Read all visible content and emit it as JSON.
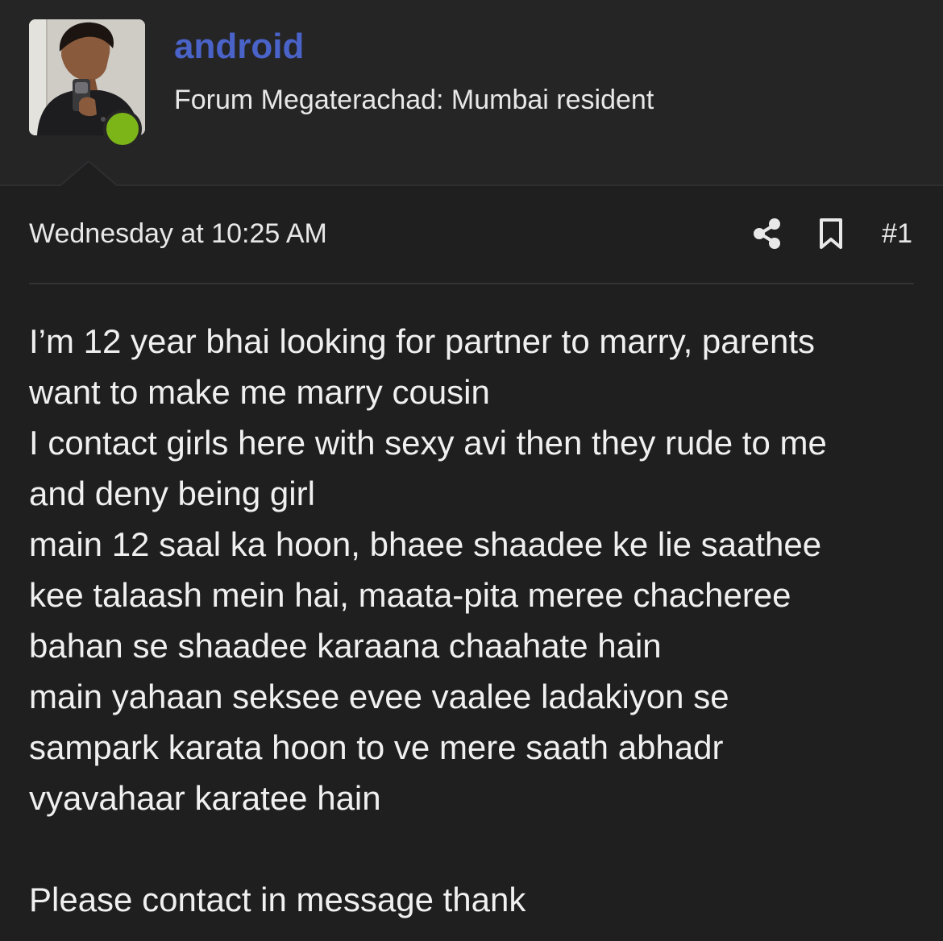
{
  "author": {
    "username": "android",
    "title": "Forum Megaterachad: Mumbai resident",
    "avatar_alt": "user avatar",
    "status": "online",
    "username_color": "#4a63c9",
    "online_color": "#7cb518"
  },
  "post": {
    "timestamp": "Wednesday at 10:25 AM",
    "number": "#1",
    "actions": [
      {
        "icon": "share-icon"
      },
      {
        "icon": "bookmark-icon"
      }
    ],
    "lines": [
      "I’m 12 year bhai looking for partner to marry, parents",
      "want to make me marry cousin",
      "I contact girls here with sexy avi then they rude to me",
      "and deny being girl",
      "main 12 saal ka hoon, bhaee shaadee ke lie saathee",
      "kee talaash mein hai, maata-pita meree chacheree",
      "bahan se shaadee karaana chaahate hain",
      "main yahaan seksee evee vaalee ladakiyon se",
      "sampark karata hoon to ve mere saath abhadr",
      "vyavahaar karatee hain",
      "",
      "Please contact in message thank"
    ]
  },
  "theme": {
    "background": "#1f1f20",
    "header_background": "#252526",
    "text": "#e8e8e8"
  }
}
